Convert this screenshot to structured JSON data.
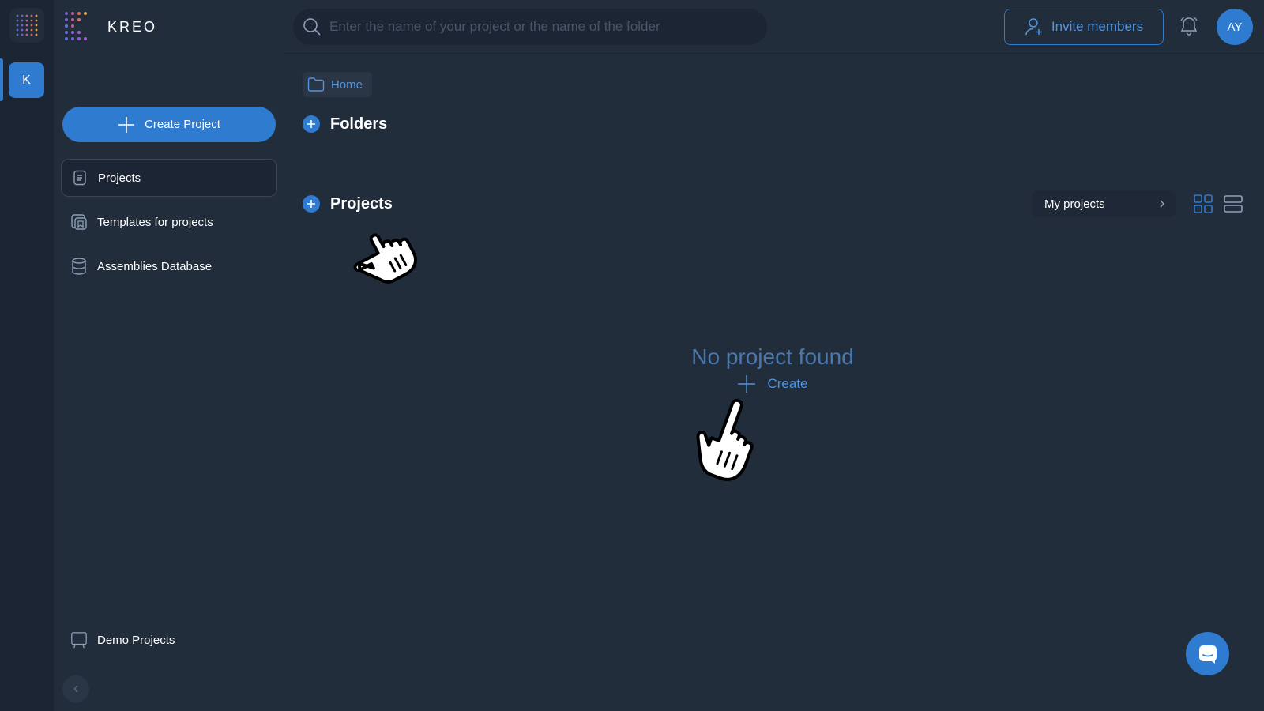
{
  "workspace": {
    "initial": "K"
  },
  "brand": {
    "name": "KREO"
  },
  "sidebar": {
    "create_label": "Create Project",
    "items": [
      {
        "label": "Projects",
        "icon": "projects-icon",
        "active": true
      },
      {
        "label": "Templates for projects",
        "icon": "templates-icon",
        "active": false
      },
      {
        "label": "Assemblies Database",
        "icon": "database-icon",
        "active": false
      }
    ],
    "demo_label": "Demo Projects"
  },
  "header": {
    "search_placeholder": "Enter the name of your project or the name of the folder",
    "invite_label": "Invite members",
    "avatar_initials": "AY"
  },
  "breadcrumb": {
    "home": "Home"
  },
  "sections": {
    "folders_title": "Folders",
    "projects_title": "Projects"
  },
  "filter": {
    "label": "My projects"
  },
  "empty_state": {
    "title": "No project found",
    "create_label": "Create"
  },
  "colors": {
    "accent": "#2e7bcf",
    "background": "#222d3c",
    "rail": "#1b2533",
    "muted_text": "#4a78ad"
  }
}
